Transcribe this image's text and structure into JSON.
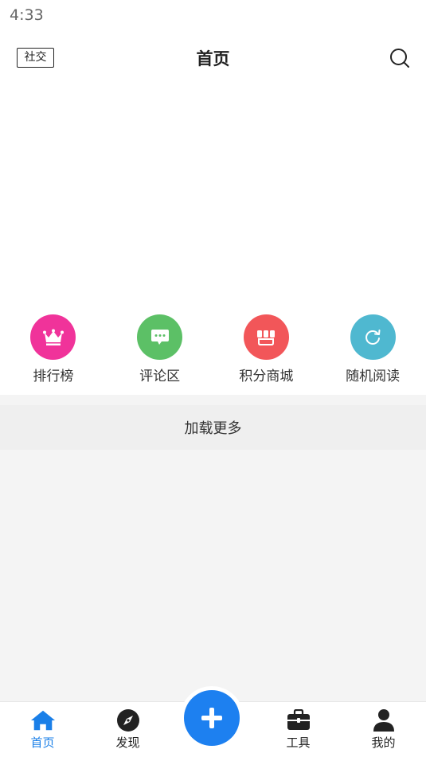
{
  "status_bar": {
    "time": "4:33"
  },
  "header": {
    "title": "首页",
    "left_button": "社交",
    "search_icon": "search-icon"
  },
  "quick_nav": [
    {
      "label": "排行榜",
      "icon": "crown-icon",
      "color": "#f0339a"
    },
    {
      "label": "评论区",
      "icon": "chat-bubble-icon",
      "color": "#5cc066"
    },
    {
      "label": "积分商城",
      "icon": "shop-icon",
      "color": "#f25659"
    },
    {
      "label": "随机阅读",
      "icon": "refresh-icon",
      "color": "#4fb8d0"
    }
  ],
  "load_more": "加载更多",
  "tabbar": {
    "tabs": [
      {
        "label": "首页",
        "icon": "home-icon",
        "active": true
      },
      {
        "label": "发现",
        "icon": "compass-icon",
        "active": false
      },
      {
        "label": "",
        "icon": "plus-icon",
        "active": false
      },
      {
        "label": "工具",
        "icon": "toolbox-icon",
        "active": false
      },
      {
        "label": "我的",
        "icon": "user-icon",
        "active": false
      }
    ],
    "active_color": "#1a7fe8",
    "fab_color": "#1d80f0"
  }
}
